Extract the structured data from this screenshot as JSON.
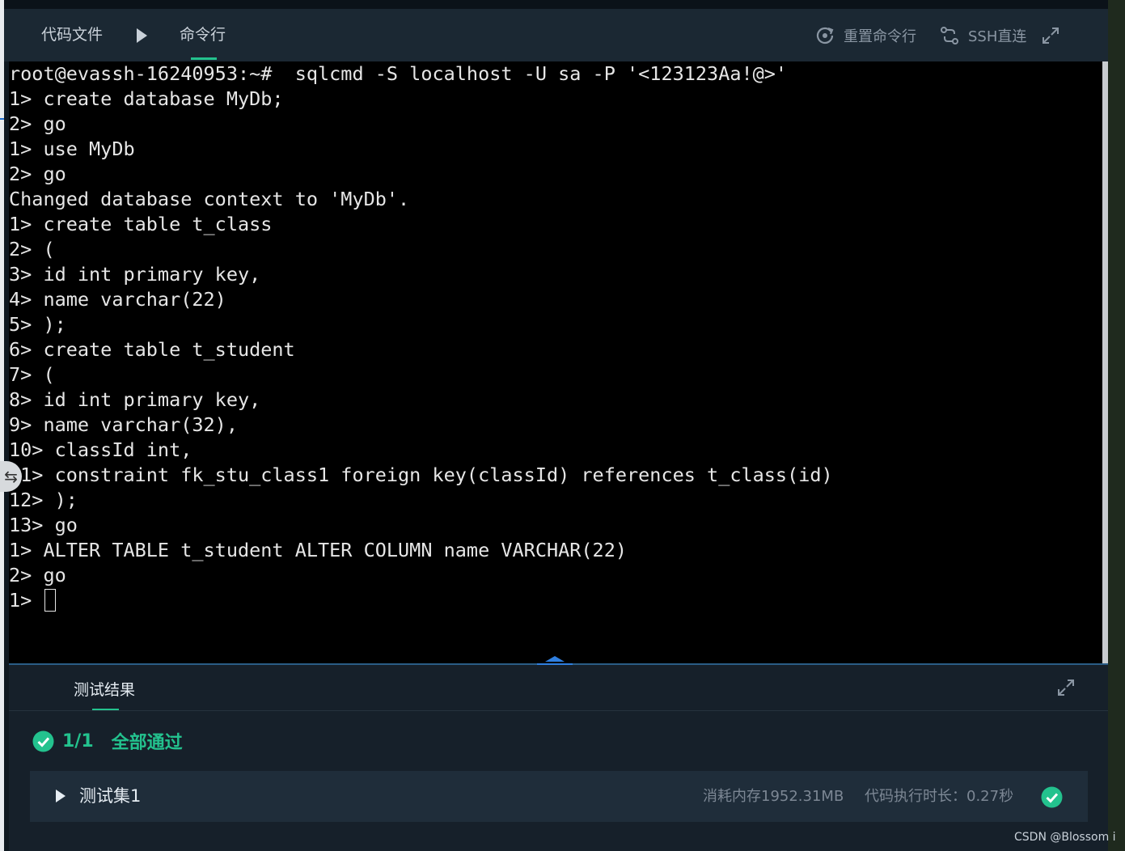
{
  "header": {
    "tab_code": "代码文件",
    "tab_cmd": "命令行",
    "reset_label": "重置命令行",
    "ssh_label": "SSH直连"
  },
  "terminal": {
    "lines": [
      "root@evassh-16240953:~#  sqlcmd -S localhost -U sa -P '<123123Aa!@>'",
      "1> create database MyDb;",
      "2> go",
      "1> use MyDb",
      "2> go",
      "Changed database context to 'MyDb'.",
      "1> create table t_class",
      "2> (",
      "3> id int primary key,",
      "4> name varchar(22)",
      "5> );",
      "6> create table t_student",
      "7> (",
      "8> id int primary key,",
      "9> name varchar(32),",
      "10> classId int,",
      "11> constraint fk_stu_class1 foreign key(classId) references t_class(id)",
      "12> );",
      "13> go",
      "1> ALTER TABLE t_student ALTER COLUMN name VARCHAR(22)",
      "2> go"
    ],
    "prompt": "1> "
  },
  "results": {
    "tab_label": "测试结果",
    "pass_count": "1/1",
    "pass_text": "全部通过",
    "testset_name": "测试集1",
    "memory": "消耗内存1952.31MB",
    "exec_time": "代码执行时长：0.27秒"
  },
  "watermark": "CSDN @Blossom i",
  "colors": {
    "accent": "#23c28e",
    "terminal_bg": "#000000",
    "panel_bg": "#16202a",
    "header_bg": "#1b2833"
  },
  "icons": [
    "play-icon",
    "reset-icon",
    "ssh-icon",
    "expand-icon",
    "check-circle-icon",
    "caret-right-icon",
    "splitter-icon"
  ]
}
